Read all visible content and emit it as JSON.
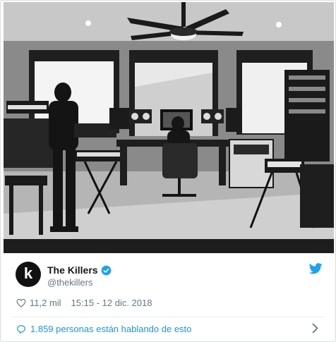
{
  "tweet": {
    "account_name": "The Killers",
    "handle": "@thekillers",
    "avatar_letter": "k",
    "likes": "11,2 mil",
    "timestamp": "15:15 - 12 dic. 2018",
    "conversation_link": "1.859 personas están hablando de esto"
  },
  "colors": {
    "twitter_blue": "#1da1f2",
    "link_blue": "#1b95e0",
    "muted_text": "#657786",
    "name_text": "#14171a"
  },
  "icons": {
    "verified": "verified-badge-icon",
    "brand": "twitter-bird-icon",
    "like": "heart-icon",
    "conversation": "speech-bubble-icon",
    "open": "chevron-right-icon"
  }
}
